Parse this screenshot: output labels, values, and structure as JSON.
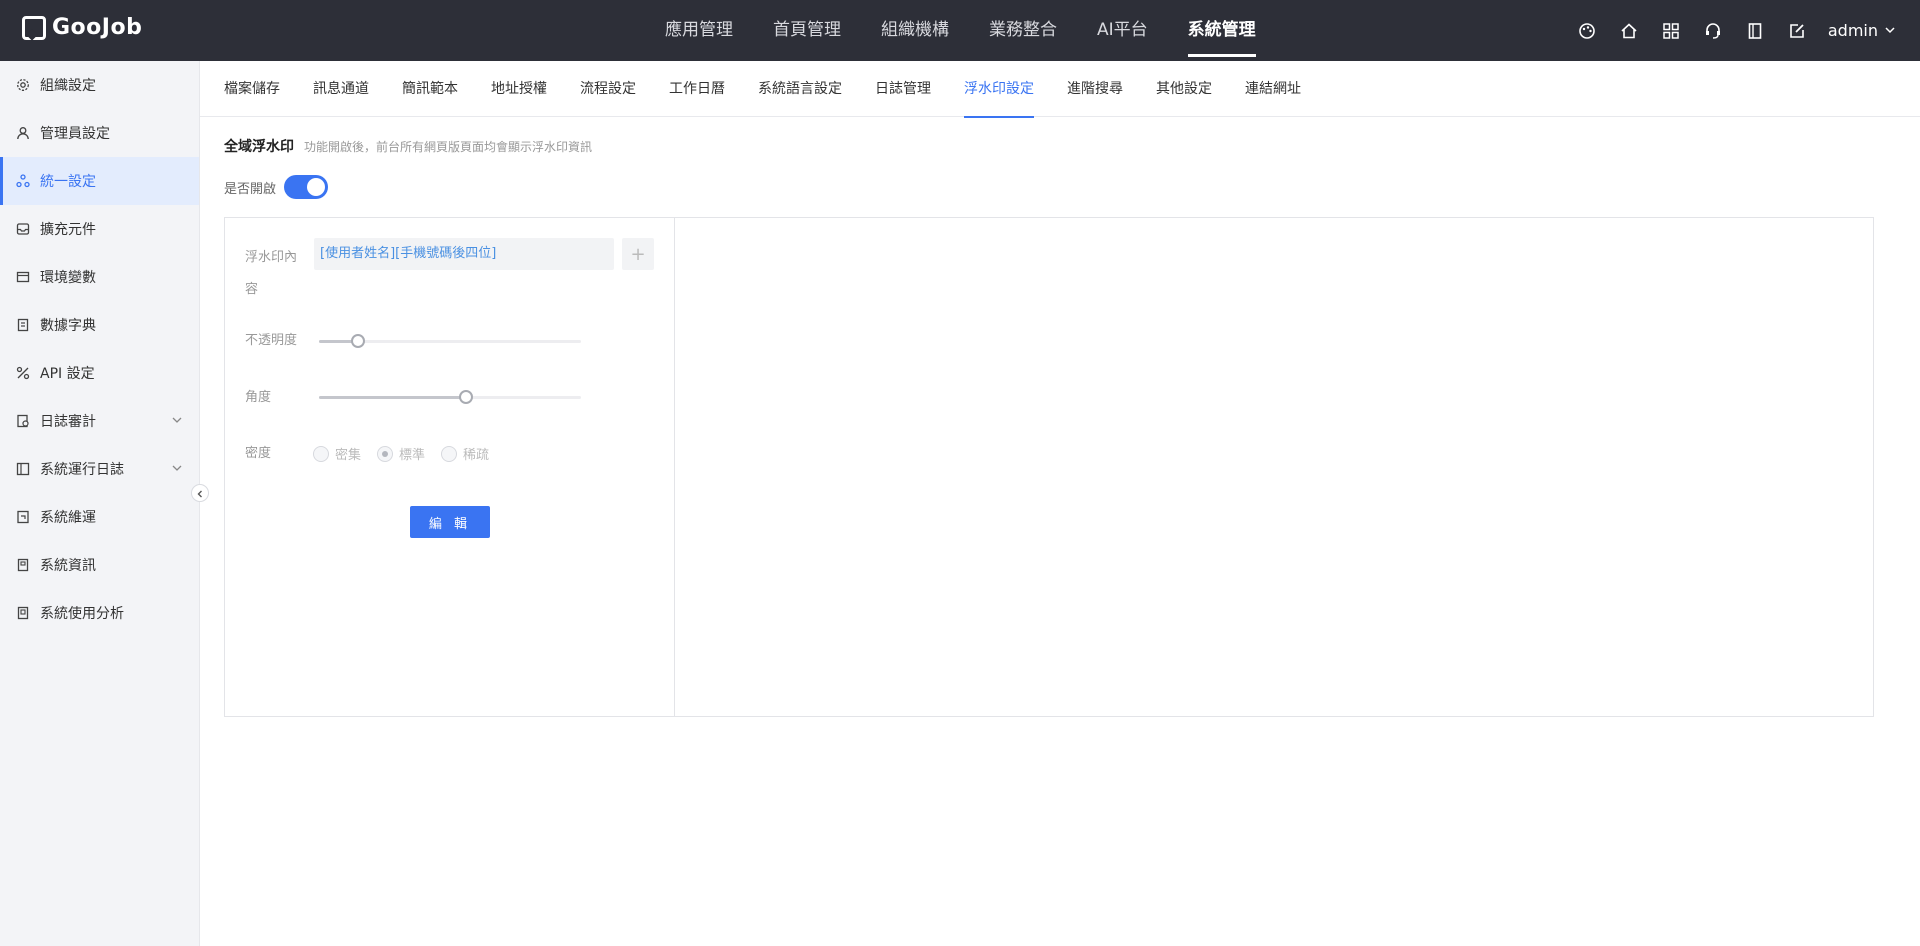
{
  "header": {
    "logo": "GooJob",
    "nav": [
      "應用管理",
      "首頁管理",
      "組織機構",
      "業務整合",
      "AI平台",
      "系統管理"
    ],
    "active_nav": "系統管理",
    "icons": [
      "palette-icon",
      "home-icon",
      "apps-grid-icon",
      "support-icon",
      "book-icon",
      "edit-square-icon"
    ],
    "user": "admin"
  },
  "sidebar": {
    "items": [
      {
        "label": "組織設定",
        "icon": "gear-icon"
      },
      {
        "label": "管理員設定",
        "icon": "user-icon"
      },
      {
        "label": "統一設定",
        "icon": "share-icon",
        "active": true
      },
      {
        "label": "擴充元件",
        "icon": "inbox-icon"
      },
      {
        "label": "環境變數",
        "icon": "terminal-icon"
      },
      {
        "label": "數據字典",
        "icon": "dictionary-icon"
      },
      {
        "label": "API 設定",
        "icon": "api-icon"
      },
      {
        "label": "日誌審計",
        "icon": "audit-icon",
        "expandable": true
      },
      {
        "label": "系統運行日誌",
        "icon": "log-icon",
        "expandable": true
      },
      {
        "label": "系統維運",
        "icon": "maintenance-icon"
      },
      {
        "label": "系統資訊",
        "icon": "info-doc-icon"
      },
      {
        "label": "系統使用分析",
        "icon": "analysis-icon"
      }
    ]
  },
  "tabs": {
    "items": [
      "檔案儲存",
      "訊息通道",
      "簡訊範本",
      "地址授權",
      "流程設定",
      "工作日曆",
      "系統語言設定",
      "日誌管理",
      "浮水印設定",
      "進階搜尋",
      "其他設定",
      "連結網址"
    ],
    "active": "浮水印設定"
  },
  "watermark": {
    "title": "全域浮水印",
    "description": "功能開啟後，前台所有網頁版頁面均會顯示浮水印資訊",
    "toggle_label": "是否開啟",
    "enabled": true,
    "content_label_1": "浮水印內",
    "content_label_2": "容",
    "content_value": "[使用者姓名][手機號碼後四位]",
    "add_symbol": "+",
    "opacity_label": "不透明度",
    "opacity": 0.15,
    "angle_label": "角度",
    "angle": 0.56,
    "density_label": "密度",
    "density_options": [
      "密集",
      "標準",
      "稀疏"
    ],
    "density_selected": "標準",
    "edit_button": "編 輯"
  }
}
